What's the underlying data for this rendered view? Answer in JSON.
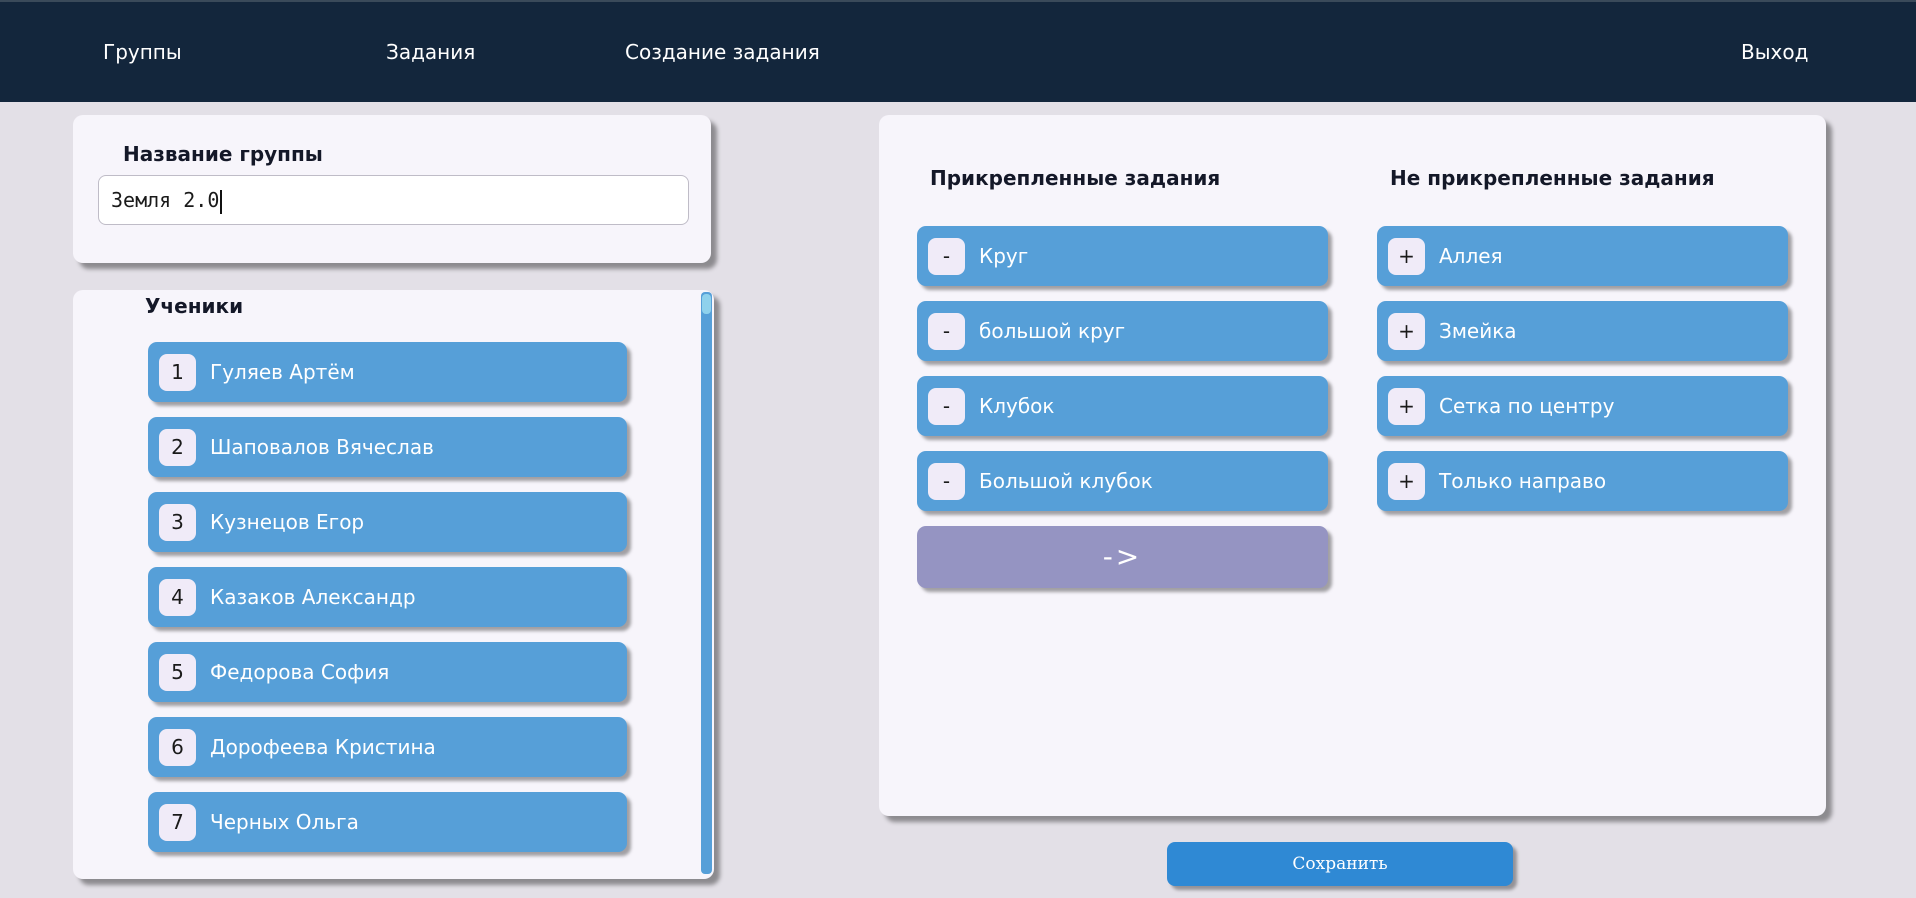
{
  "nav": {
    "groups": "Группы",
    "tasks": "Задания",
    "create_task": "Создание задания",
    "logout": "Выход"
  },
  "group_name": {
    "title": "Название группы",
    "value": "Земля 2.0"
  },
  "students": {
    "title": "Ученики",
    "items": [
      {
        "num": "1",
        "name": "Гуляев Артём"
      },
      {
        "num": "2",
        "name": "Шаповалов Вячеслав"
      },
      {
        "num": "3",
        "name": "Кузнецов Егор"
      },
      {
        "num": "4",
        "name": "Казаков Александр"
      },
      {
        "num": "5",
        "name": "Федорова София"
      },
      {
        "num": "6",
        "name": "Дорофеева Кристина"
      },
      {
        "num": "7",
        "name": "Черных Ольга"
      }
    ]
  },
  "attached": {
    "title": "Прикрепленные задания",
    "items": [
      {
        "symbol": "-",
        "name": "Круг"
      },
      {
        "symbol": "-",
        "name": "большой круг"
      },
      {
        "symbol": "-",
        "name": "Клубок"
      },
      {
        "symbol": "-",
        "name": "Большой клубок"
      }
    ],
    "arrow_label": "->"
  },
  "unattached": {
    "title": "Не прикрепленные задания",
    "items": [
      {
        "symbol": "+",
        "name": "Аллея"
      },
      {
        "symbol": "+",
        "name": "Змейка"
      },
      {
        "symbol": "+",
        "name": "Сетка по центру"
      },
      {
        "symbol": "+",
        "name": "Только направо"
      }
    ]
  },
  "save_label": "Сохранить",
  "colors": {
    "topbar": "#13263c",
    "background": "#e3e0e7",
    "pill": "#569fd8",
    "arrow_button": "#9594c2",
    "save_button": "#2f89d4"
  }
}
